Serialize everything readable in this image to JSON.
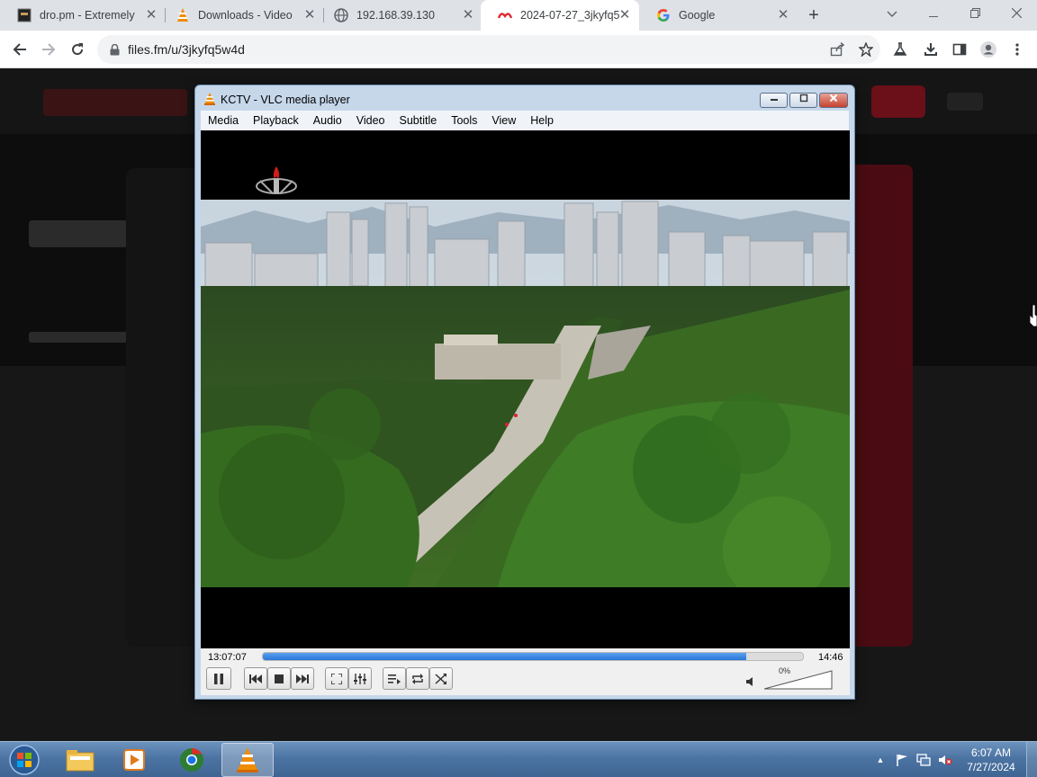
{
  "browser": {
    "tabs": [
      {
        "title": "dro.pm - Extremely",
        "icon": "dro-icon"
      },
      {
        "title": "Downloads - Video",
        "icon": "vlc-cone-icon"
      },
      {
        "title": "192.168.39.130",
        "icon": "globe-icon"
      },
      {
        "title": "2024-07-27_3jkyfq5",
        "icon": "filesfm-icon",
        "active": true
      },
      {
        "title": "Google",
        "icon": "google-icon"
      }
    ],
    "close_glyph": "✕",
    "new_tab_glyph": "+",
    "url": "files.fm/u/3jkyfq5w4d"
  },
  "vlc": {
    "title": "KCTV - VLC media player",
    "menu": [
      "Media",
      "Playback",
      "Audio",
      "Video",
      "Subtitle",
      "Tools",
      "View",
      "Help"
    ],
    "elapsed": "13:07:07",
    "remaining": "14:46",
    "progress_fraction": 0.895,
    "volume_label": "0%",
    "volume_level": 0
  },
  "taskbar": {
    "time": "6:07 AM",
    "date": "7/27/2024",
    "tray_arrow": "▲"
  },
  "colors": {
    "vlc_frame": "#c6d7ea",
    "seek_fill": "#2a77d6",
    "taskbar": "#4c74a3"
  }
}
